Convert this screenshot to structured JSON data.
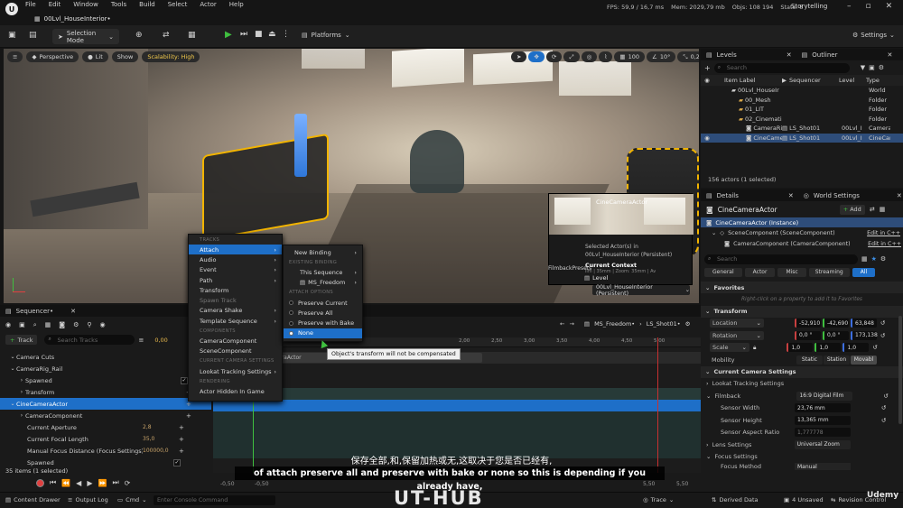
{
  "window": {
    "tab_label": "00Lvl_HouseInterior•",
    "menu": [
      "File",
      "Edit",
      "Window",
      "Tools",
      "Build",
      "Select",
      "Actor",
      "Help"
    ],
    "stats": {
      "fps_label": "FPS",
      "fps_value": "59,9",
      "ms_value": "/ 16,7 ms",
      "mem_label": "Mem:",
      "mem_value": "2029,79 mb",
      "objs_label": "Objs:",
      "objs_value": "108 194",
      "stats_label": "Stats:",
      "stats_value": "8"
    },
    "layout_name": "Storytelling"
  },
  "toolbar": {
    "selection_mode": "Selection Mode",
    "platforms": "Platforms",
    "settings": "Settings"
  },
  "viewport": {
    "perspective": "Perspective",
    "lit": "Lit",
    "show": "Show",
    "scalability": "Scalability: High",
    "grid_value": "100",
    "angle_value": "10°",
    "scale_value": "0,25",
    "cam_speed": "4",
    "pip_label": "CineCameraActor",
    "filmback_label": "FilmbackPresets",
    "filmback_info": "ilm | 35mm | Zoom: 35mm | Av",
    "selected_actors": "Selected Actor(s) in",
    "selected_level": "00Lvl_HouseInterior (Persistent)",
    "current_context": "Current Context",
    "level_label": "Level",
    "level_value": "00Lvl_HouseInterior (Persistent)"
  },
  "context_menu": {
    "header_tracks": "TRACKS",
    "items": [
      {
        "label": "Attach",
        "arrow": "›",
        "selected": true
      },
      {
        "label": "Audio",
        "arrow": "›"
      },
      {
        "label": "Event",
        "arrow": "›"
      },
      {
        "label": "Path",
        "arrow": "›"
      },
      {
        "label": "Transform",
        "arrow": ""
      }
    ],
    "spawn_track": "Spawn Track",
    "items2": [
      {
        "label": "Camera Shake",
        "arrow": "›"
      },
      {
        "label": "Template Sequence",
        "arrow": "›"
      }
    ],
    "header_components": "COMPONENTS",
    "components": [
      "CameraComponent",
      "SceneComponent"
    ],
    "header_current_camera": "CURRENT CAMERA SETTINGS",
    "lookat": "Lookat Tracking Settings",
    "lookat_arrow": "›",
    "header_rendering": "RENDERING",
    "actor_hidden": "Actor Hidden In Game"
  },
  "submenu": {
    "new_binding": "New Binding",
    "new_binding_arrow": "›",
    "header_existing": "EXISTING BINDING",
    "this_sequence": "This Sequence",
    "this_sequence_arrow": "›",
    "ms_freedom": "MS_Freedom",
    "ms_freedom_arrow": "›",
    "header_attach": "ATTACH OPTIONS",
    "options": [
      {
        "label": "Preserve Current",
        "selected": false
      },
      {
        "label": "Preserve All",
        "selected": false
      },
      {
        "label": "Preserve with Bake",
        "selected": false
      },
      {
        "label": "None",
        "selected": true
      }
    ],
    "tooltip": "Object's transform will not be compensated"
  },
  "levels_panel": {
    "tab_levels": "Levels",
    "tab_outliner": "Outliner",
    "search_placeholder": "Search",
    "col_label": "Item Label",
    "col_sequencer": "Sequencer",
    "col_level": "Level",
    "col_type": "Type",
    "rows": [
      {
        "label": "00Lvl_HouseIr",
        "sequencer": "",
        "level": "",
        "type": "World",
        "indent": 0,
        "selected": false
      },
      {
        "label": "00_Mesh",
        "sequencer": "",
        "level": "",
        "type": "Folder",
        "indent": 1,
        "selected": false
      },
      {
        "label": "01_LIT",
        "sequencer": "",
        "level": "",
        "type": "Folder",
        "indent": 1,
        "selected": false
      },
      {
        "label": "02_Cinemati",
        "sequencer": "",
        "level": "",
        "type": "Folder",
        "indent": 1,
        "selected": false
      },
      {
        "label": "CameraRig_I",
        "sequencer": "LS_Shot01",
        "level": "00Lvl_I",
        "type": "Camera",
        "indent": 2,
        "selected": false
      },
      {
        "label": "CineCamera",
        "sequencer": "LS_Shot01",
        "level": "00Lvl_I",
        "type": "CineCar",
        "indent": 2,
        "selected": true
      }
    ],
    "actor_count": "156 actors (1 selected)"
  },
  "details_panel": {
    "tab_details": "Details",
    "tab_world": "World Settings",
    "actor_name": "CineCameraActor",
    "add_label": "Add",
    "instance_label": "CineCameraActor (Instance)",
    "scene_component": "SceneComponent (SceneComponent)",
    "camera_component": "CameraComponent (CameraComponent)",
    "edit_cpp": "Edit in C++",
    "search_placeholder": "Search",
    "filters": [
      "General",
      "Actor",
      "Misc",
      "Streaming",
      "All"
    ],
    "favorites": "Favorites",
    "favorites_hint": "Right-click on a property to add it to Favorites",
    "transform": "Transform",
    "location": "Location",
    "location_values": [
      "-52,910",
      "-42,690",
      "63,848"
    ],
    "rotation": "Rotation",
    "rotation_values": [
      "0,0 °",
      "0,0 °",
      "173,138"
    ],
    "scale": "Scale",
    "scale_values": [
      "1,0",
      "1,0",
      "1,0"
    ],
    "mobility": "Mobility",
    "mobility_options": [
      "Static",
      "Station",
      "Movabl"
    ],
    "current_camera": "Current Camera Settings",
    "lookat": "Lookat Tracking Settings",
    "filmback": "Filmback",
    "filmback_value": "16:9 Digital Film",
    "sensor_width": "Sensor Width",
    "sensor_width_value": "23,76 mm",
    "sensor_height": "Sensor Height",
    "sensor_height_value": "13,365 mm",
    "sensor_aspect": "Sensor Aspect Ratio",
    "sensor_aspect_value": "1,777778",
    "lens_settings": "Lens Settings",
    "lens_value": "Universal Zoom",
    "focus_settings": "Focus Settings",
    "focus_method": "Focus Method",
    "focus_method_value": "Manual"
  },
  "sequencer": {
    "tab": "Sequencer•",
    "track_button": "Track",
    "search_placeholder": "Search Tracks",
    "time_value": "0,00",
    "breadcrumb_1": "MS_Freedom•",
    "breadcrumb_2": "LS_Shot01•",
    "ruler": [
      "2,00",
      "2,50",
      "3,00",
      "3,50",
      "4,00",
      "4,50",
      "5,00"
    ],
    "tracks": [
      {
        "label": "Camera Cuts",
        "indent": 0,
        "highlight": false
      },
      {
        "label": "CameraRig_Rail",
        "indent": 0,
        "highlight": false
      },
      {
        "label": "Spawned",
        "indent": 1,
        "highlight": false
      },
      {
        "label": "Transform",
        "indent": 1,
        "highlight": false
      },
      {
        "label": "CineCameraActor",
        "indent": 0,
        "highlight": true
      },
      {
        "label": "CameraComponent",
        "indent": 1,
        "highlight": false
      },
      {
        "label": "Current Aperture",
        "indent": 2,
        "highlight": false
      },
      {
        "label": "Current Focal Length",
        "indent": 2,
        "highlight": false
      },
      {
        "label": "Manual Focus Distance (Focus Settings)",
        "indent": 2,
        "highlight": false
      },
      {
        "label": "Spawned",
        "indent": 2,
        "highlight": false
      }
    ],
    "track_values": [
      "",
      "",
      "",
      "",
      "",
      "",
      "2,8",
      "35,0",
      "100000,0",
      ""
    ],
    "clip_label": "eraActor",
    "items_count": "35 items (1 selected)",
    "time_start": "-0,50",
    "time_start2": "-0,50",
    "time_end": "5,50",
    "time_end2": "5,50"
  },
  "subtitles": {
    "chinese": "保存全部,和,保留加热或无,这取决于您是否已经有,",
    "english": "of attach preserve all and preserve with bake or none so this is depending if you already have,"
  },
  "watermark": "UT-HUB",
  "bottom_bar": {
    "content_drawer": "Content Drawer",
    "output_log": "Output Log",
    "cmd": "Cmd",
    "console_placeholder": "Enter Console Command",
    "trace": "Trace",
    "derived_data": "Derived Data",
    "unsaved": "4 Unsaved",
    "revision": "Revision Control",
    "udemy": "Udemy"
  },
  "colors": {
    "accent_blue": "#1e6fc8",
    "selection_yellow": "#f2b400",
    "play_green": "#3fbf3f"
  }
}
